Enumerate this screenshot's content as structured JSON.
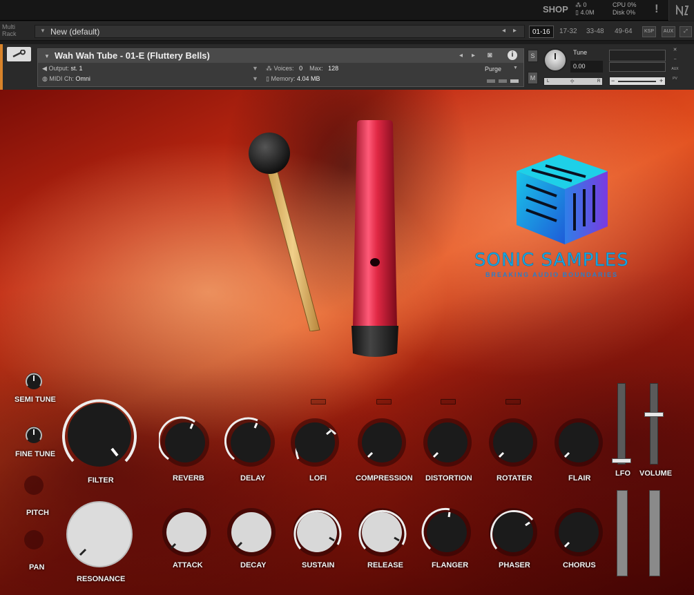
{
  "topbar": {
    "shop_label": "SHOP",
    "voices_line": "⁂ 0",
    "memory_line": "▯ 4.0M",
    "cpu_line": "CPU 0%",
    "disk_line": "Disk 0%",
    "warning_glyph": "!"
  },
  "rack": {
    "label_line1": "Multi",
    "label_line2": "Rack",
    "name": "New (default)",
    "prev_glyph": "◂",
    "next_glyph": "▸",
    "tabs": [
      "01-16",
      "17-32",
      "33-48",
      "49-64"
    ],
    "active_tab": "01-16",
    "ksp_label": "KSP",
    "aux_label": "AUX"
  },
  "instrument": {
    "name": "Wah Wah Tube - 01-E (Fluttery Bells)",
    "output_label": "Output:",
    "output_value": "st. 1",
    "midi_label": "MIDI Ch:",
    "midi_value": "Omni",
    "voices_label": "Voices:",
    "voices_value": "0",
    "max_label": "Max:",
    "max_value": "128",
    "memory_label": "Memory:",
    "memory_value": "4.04 MB",
    "purge_label": "Purge",
    "solo_label": "S",
    "mute_label": "M",
    "tune_label": "Tune",
    "tune_value": "0.00",
    "pan_left": "L",
    "pan_center": "‹|›",
    "pan_right": "R",
    "vol_minus": "−",
    "vol_plus": "+",
    "aux_side": "AUX",
    "pv_side": "PV"
  },
  "brand": {
    "name": "SONIC SAMPLES",
    "tagline": "BREAKING AUDIO BOUNDARIES"
  },
  "controls": {
    "semi_tune": "SEMI TUNE",
    "fine_tune": "FINE TUNE",
    "pitch": "PITCH",
    "pan": "PAN",
    "filter": "FILTER",
    "resonance": "RESONANCE",
    "reverb": "REVERB",
    "delay": "DELAY",
    "lofi": "LOFI",
    "compression": "COMPRESSION",
    "distortion": "DISTORTION",
    "rotater": "ROTATER",
    "flair": "FLAIR",
    "attack": "ATTACK",
    "decay": "DECAY",
    "sustain": "SUSTAIN",
    "release": "RELEASE",
    "flanger": "FLANGER",
    "phaser": "PHASER",
    "chorus": "CHORUS",
    "lfo": "LFO",
    "volume": "VOLUME"
  },
  "colors": {
    "accent_orange": "#d8832a",
    "brand_blue": "#1aa8e0",
    "tube_red": "#d8203a"
  }
}
